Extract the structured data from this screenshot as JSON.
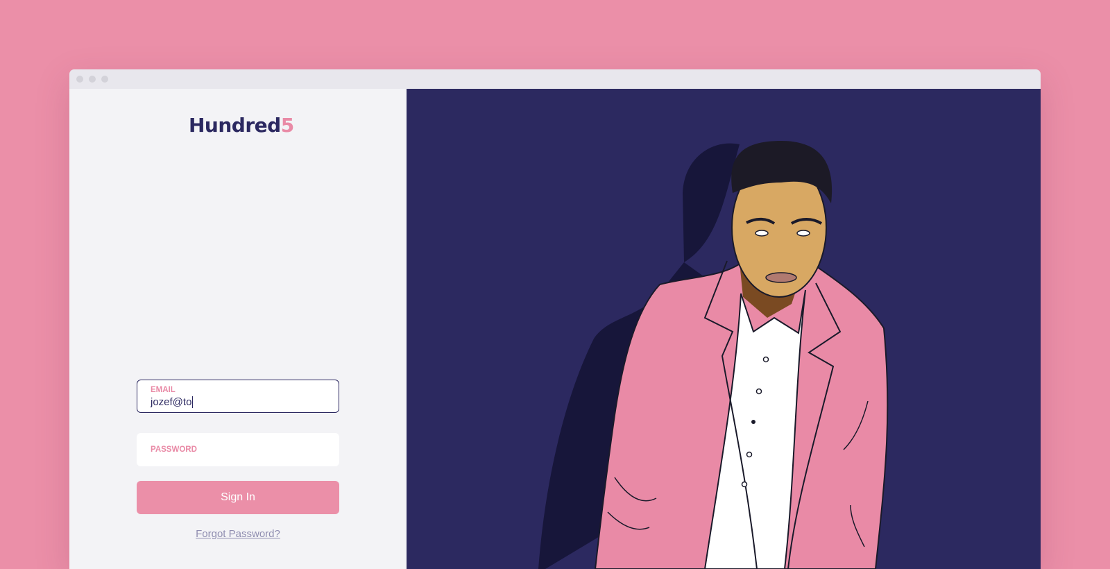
{
  "brand": {
    "logo_main": "Hundred",
    "logo_accent": "5"
  },
  "login": {
    "email": {
      "label": "EMAIL",
      "value": "jozef@to"
    },
    "password": {
      "label": "PASSWORD",
      "value": ""
    },
    "sign_in_label": "Sign In",
    "forgot_label": "Forgot Password?"
  },
  "illustration": {
    "subject": "man-in-pink-suit"
  },
  "colors": {
    "background": "#eb8fa8",
    "panel_dark": "#2c2960",
    "brand_navy": "#2b2860",
    "brand_pink": "#e98aa6",
    "form_bg": "#f3f3f6"
  }
}
